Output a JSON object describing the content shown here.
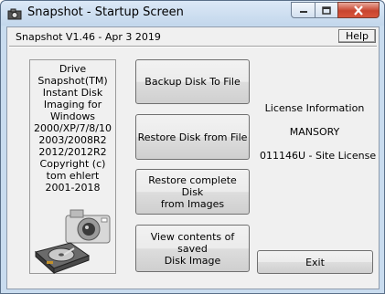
{
  "window": {
    "title": "Snapshot - Startup Screen"
  },
  "header": {
    "version": "Snapshot V1.46 - Apr  3 2019",
    "help_label": "Help"
  },
  "info_panel": {
    "lines": [
      "Drive",
      "Snapshot(TM)",
      "Instant Disk",
      "Imaging for",
      "Windows",
      "2000/XP/7/8/10",
      "2003/2008R2",
      "2012/2012R2",
      "Copyright (c)",
      "tom ehlert",
      "2001-2018"
    ]
  },
  "actions": {
    "backup_line1": "Backup Disk To File",
    "restore_line1": "Restore Disk from File",
    "restore_complete_line1": "Restore complete Disk",
    "restore_complete_line2": "from Images",
    "view_line1": "View contents of saved",
    "view_line2": "Disk Image"
  },
  "license": {
    "title": "License Information",
    "name": "MANSORY",
    "id": "011146U - Site License"
  },
  "exit_label": "Exit",
  "icons": {
    "app": "camera-app-icon",
    "camera": "camera-icon",
    "hdd": "hard-disk-icon"
  },
  "colors": {
    "titlebar": "#c9dcef",
    "client": "#f0f0f0",
    "close": "#c8452f"
  }
}
